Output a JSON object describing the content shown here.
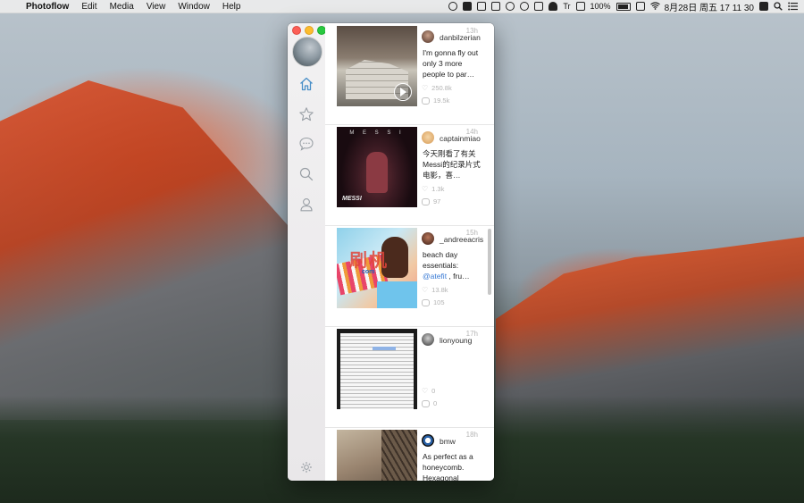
{
  "menubar": {
    "apple": "",
    "app_name": "Photoflow",
    "menus": [
      "Edit",
      "Media",
      "View",
      "Window",
      "Help"
    ],
    "battery_percent": "100%",
    "input_method": "Tr",
    "date_time": "8月28日 周五  17 11 30"
  },
  "window": {
    "nav": [
      "home",
      "favorites",
      "messages",
      "search",
      "profile"
    ],
    "settings": "settings"
  },
  "feed": {
    "posts": [
      {
        "time": "13h",
        "username": "danbilzerian",
        "caption": "I'm gonna fly out only 3 more people to par…",
        "likes": "250.8k",
        "comments": "19.5k"
      },
      {
        "time": "14h",
        "username": "captainmiao",
        "caption": "今天刚看了有关Messi的纪录片式电影，喜…",
        "likes": "1.3k",
        "comments": "97",
        "image_text_top": "M E S S I",
        "image_text_bottom": "MESSI"
      },
      {
        "time": "15h",
        "username": "_andreeacris",
        "caption_pre": "beach day essentials: ",
        "caption_tag": "@atefit",
        "caption_post": " , fru…",
        "likes": "13.8k",
        "comments": "105",
        "watermark": "刷机",
        "watermark_sub": "com"
      },
      {
        "time": "17h",
        "username": "lionyoung",
        "caption": "",
        "likes": "0",
        "comments": "0"
      },
      {
        "time": "18h",
        "username": "bmw",
        "caption": "As perfect as a honeycomb. Hexagonal",
        "likes": "",
        "comments": ""
      }
    ]
  },
  "colors": {
    "accent": "#3a7bd5",
    "close": "#fc5f57",
    "minimize": "#fdbc2e",
    "zoom": "#28c840"
  }
}
